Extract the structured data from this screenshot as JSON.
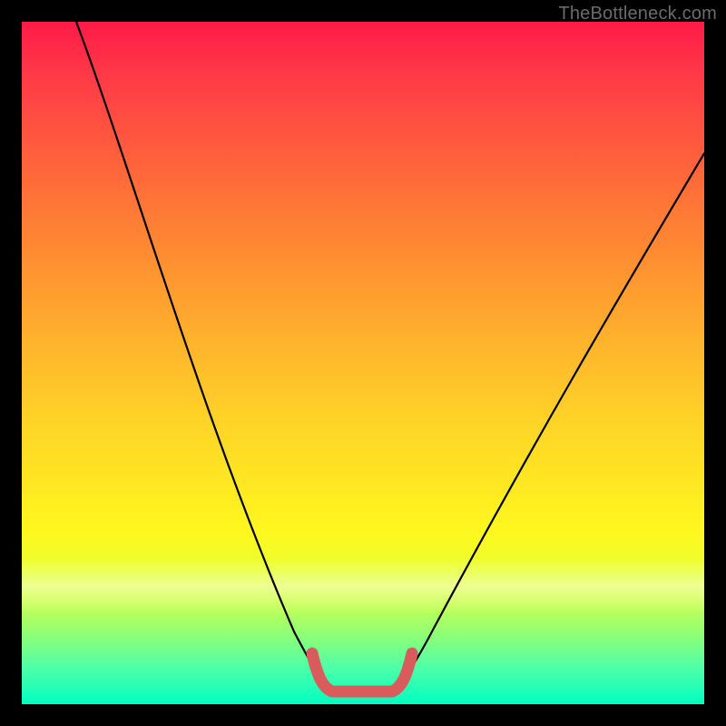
{
  "watermark": "TheBottleneck.com",
  "colors": {
    "frame": "#000000",
    "curve": "#000000",
    "bracket": "#d95b5b",
    "gradient_top": "#ff1a47",
    "gradient_bottom": "#00ffc0"
  },
  "chart_data": {
    "type": "line",
    "title": "",
    "xlabel": "",
    "ylabel": "",
    "xlim": [
      0,
      100
    ],
    "ylim": [
      0,
      100
    ],
    "grid": false,
    "legend": false,
    "series": [
      {
        "name": "bottleneck-curve",
        "x": [
          8,
          12,
          16,
          20,
          24,
          28,
          32,
          36,
          40,
          42,
          44,
          46,
          48,
          50,
          52,
          54,
          56,
          60,
          64,
          68,
          72,
          76,
          80,
          84,
          88,
          92,
          96,
          100
        ],
        "values": [
          100,
          90,
          80,
          71,
          62,
          53,
          44,
          35,
          24,
          17,
          10,
          4,
          1,
          0,
          0,
          1,
          4,
          12,
          21,
          30,
          38,
          46,
          53,
          60,
          66,
          72,
          77,
          81
        ]
      }
    ],
    "annotations": [
      {
        "name": "optimal-range-bracket",
        "type": "range",
        "axis": "x",
        "from": 44,
        "to": 56,
        "y": 3
      }
    ]
  }
}
